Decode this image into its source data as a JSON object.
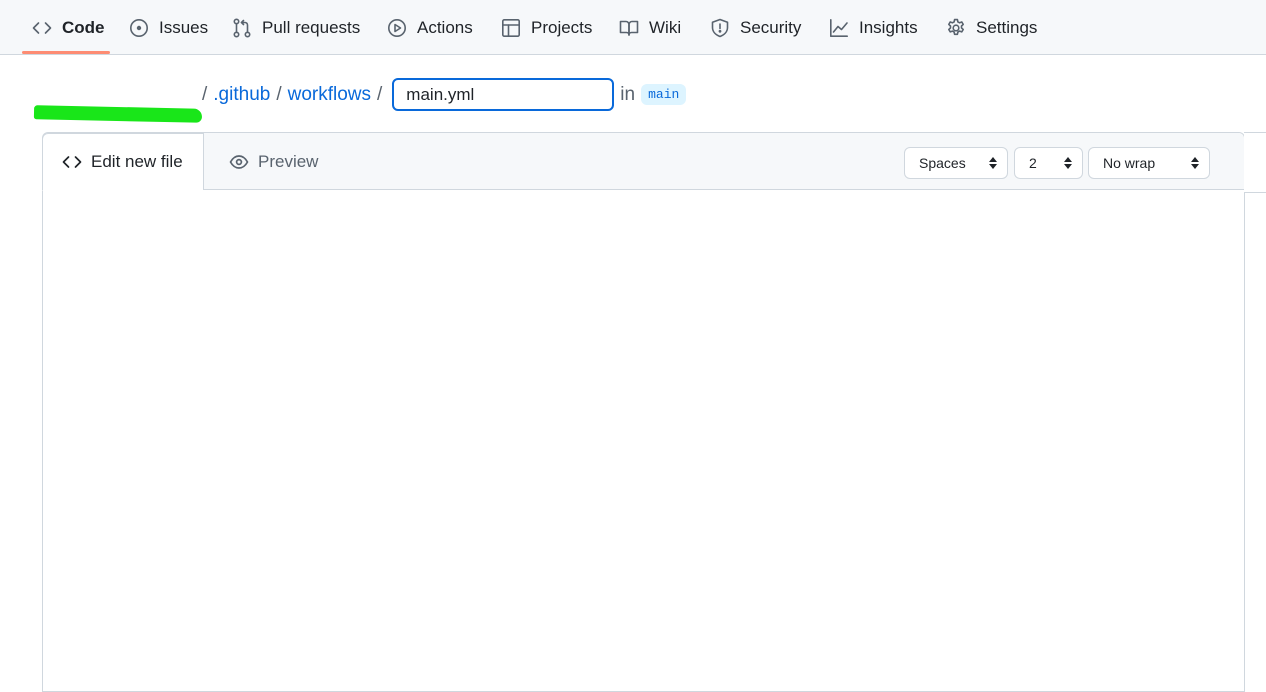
{
  "repo_nav": {
    "items": [
      {
        "label": "Code",
        "icon": "code-icon",
        "selected": true
      },
      {
        "label": "Issues",
        "icon": "issue-opened-icon"
      },
      {
        "label": "Pull requests",
        "icon": "git-pull-request-icon"
      },
      {
        "label": "Actions",
        "icon": "play-icon"
      },
      {
        "label": "Projects",
        "icon": "table-icon"
      },
      {
        "label": "Wiki",
        "icon": "book-icon"
      },
      {
        "label": "Security",
        "icon": "shield-icon"
      },
      {
        "label": "Insights",
        "icon": "graph-icon"
      },
      {
        "label": "Settings",
        "icon": "gear-icon"
      }
    ],
    "accent": "#fd8c73"
  },
  "breadcrumb": {
    "owner_redacted": true,
    "redaction_color": "#19e619",
    "segments": [
      ".github",
      "workflows"
    ],
    "separator": "/",
    "filename_value": "main.yml",
    "in_label": "in",
    "branch": "main"
  },
  "editor": {
    "tabs": {
      "edit": {
        "label": "Edit new file",
        "icon": "code-icon"
      },
      "preview": {
        "label": "Preview",
        "icon": "eye-icon"
      }
    },
    "indent_mode": "Spaces",
    "indent_size": "2",
    "wrap_mode": "No wrap",
    "content": ""
  }
}
